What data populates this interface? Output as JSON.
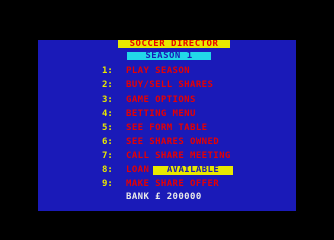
{
  "game": {
    "title": "SOCCER DIRECTOR",
    "season": "SEASON  1"
  },
  "menu": {
    "items": [
      {
        "num": "1:",
        "label": "PLAY SEASON"
      },
      {
        "num": "2:",
        "label": "BUY/SELL SHARES"
      },
      {
        "num": "3:",
        "label": "GAME OPTIONS"
      },
      {
        "num": "4:",
        "label": "BETTING MENU"
      },
      {
        "num": "5:",
        "label": "SEE FORM TABLE"
      },
      {
        "num": "6:",
        "label": "SEE SHARES OWNED"
      },
      {
        "num": "7:",
        "label": "CALL SHARE MEETING"
      },
      {
        "num": "8:",
        "label": "LOAN"
      },
      {
        "num": "9:",
        "label": "MAKE SHARE OFFER"
      }
    ],
    "loan_status": "AVAILABLE"
  },
  "bank": {
    "text": "BANK £ 200000"
  },
  "colors": {
    "background": "#000000",
    "panel": "#1a1ab8",
    "title_bg": "#e8e800",
    "title_text": "#e80000",
    "season_bg": "#22d8e8",
    "numbers": "#e8e800",
    "menu_text": "#e80000",
    "bank_text": "#e8e8e8"
  }
}
